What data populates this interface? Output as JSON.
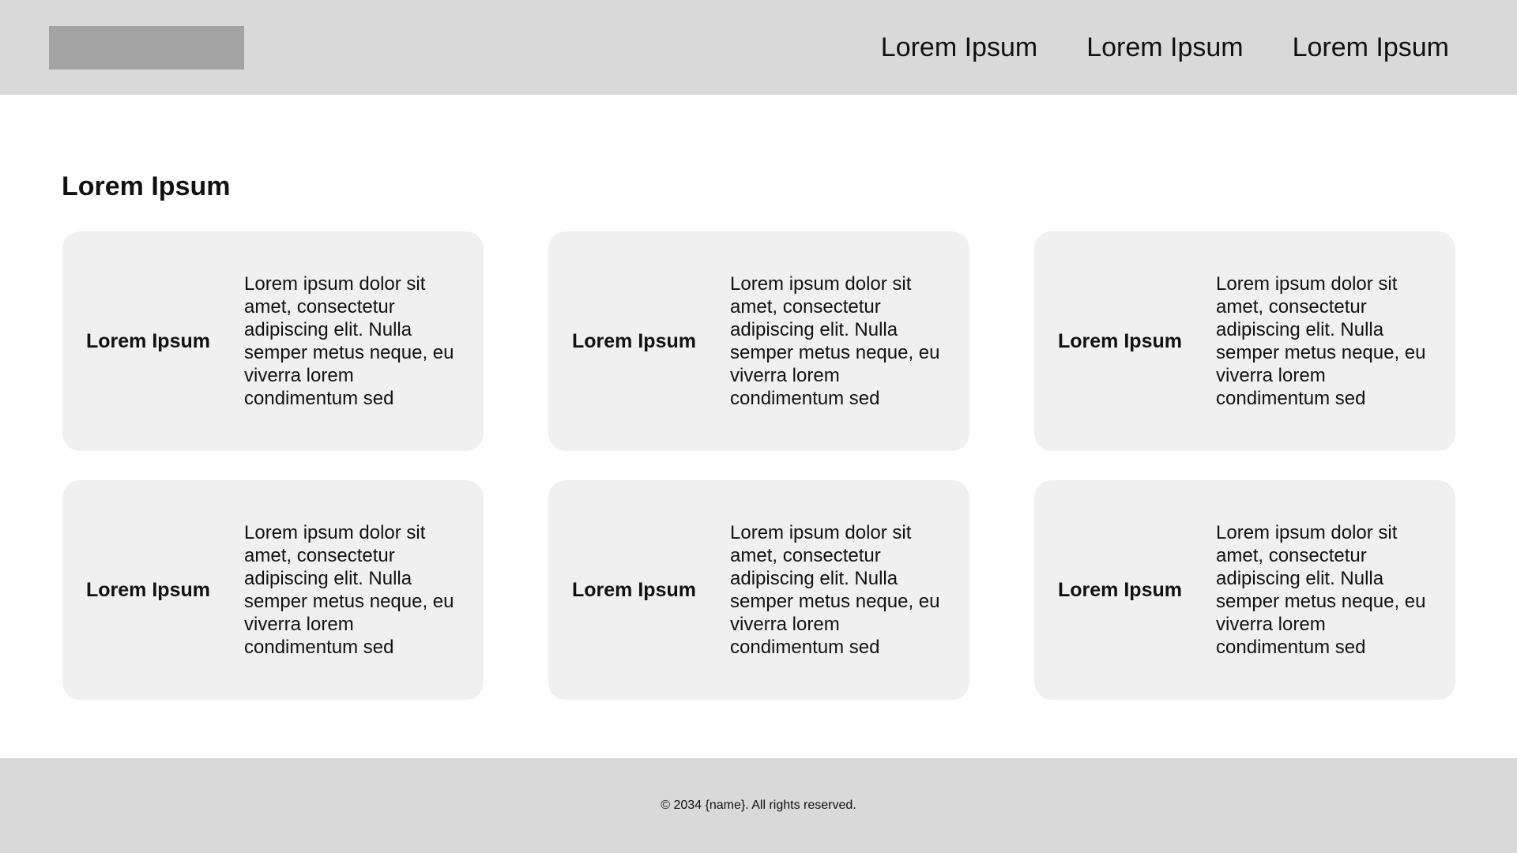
{
  "header": {
    "logo_color": "#a3a3a3",
    "background_color": "#d9d9d9",
    "nav_links": [
      "Lorem Ipsum",
      "Lorem Ipsum",
      "Lorem Ipsum"
    ]
  },
  "section": {
    "title": "Lorem Ipsum",
    "cards": [
      {
        "label": "Lorem Ipsum",
        "text": "Lorem ipsum dolor sit amet, consectetur adipiscing elit. Nulla semper metus neque, eu viverra lorem condimentum sed"
      },
      {
        "label": "Lorem Ipsum",
        "text": "Lorem ipsum dolor sit amet, consectetur adipiscing elit. Nulla semper metus neque, eu viverra lorem condimentum sed"
      },
      {
        "label": "Lorem Ipsum",
        "text": "Lorem ipsum dolor sit amet, consectetur adipiscing elit. Nulla semper metus neque, eu viverra lorem condimentum sed"
      },
      {
        "label": "Lorem Ipsum",
        "text": "Lorem ipsum dolor sit amet, consectetur adipiscing elit. Nulla semper metus neque, eu viverra lorem condimentum sed"
      },
      {
        "label": "Lorem Ipsum",
        "text": "Lorem ipsum dolor sit amet, consectetur adipiscing elit. Nulla semper metus neque, eu viverra lorem condimentum sed"
      },
      {
        "label": "Lorem Ipsum",
        "text": "Lorem ipsum dolor sit amet, consectetur adipiscing elit. Nulla semper metus neque, eu viverra lorem condimentum sed"
      }
    ],
    "card_color": "#f0f0f0"
  },
  "footer": {
    "text": "© 2034 {name}. All rights reserved.",
    "background_color": "#d9d9d9"
  }
}
